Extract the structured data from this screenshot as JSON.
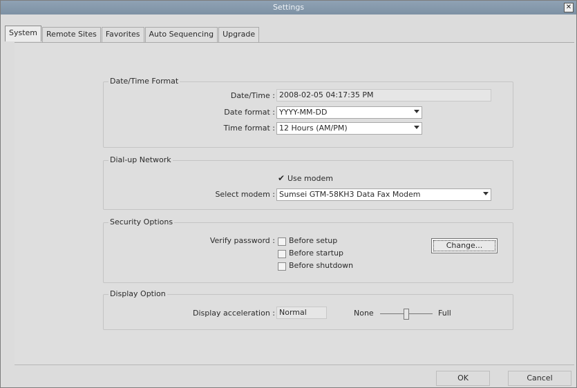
{
  "window": {
    "title": "Settings"
  },
  "tabs": [
    {
      "label": "System"
    },
    {
      "label": "Remote Sites"
    },
    {
      "label": "Favorites"
    },
    {
      "label": "Auto Sequencing"
    },
    {
      "label": "Upgrade"
    }
  ],
  "datetime": {
    "group_title": "Date/Time Format",
    "datetime_label": "Date/Time :",
    "datetime_value": "2008-02-05 04:17:35 PM",
    "date_format_label": "Date format :",
    "date_format_value": "YYYY-MM-DD",
    "time_format_label": "Time format :",
    "time_format_value": "12 Hours (AM/PM)"
  },
  "dialup": {
    "group_title": "Dial-up Network",
    "use_modem_label": "Use modem",
    "use_modem_checked": true,
    "select_modem_label": "Select modem :",
    "select_modem_value": "Sumsei GTM-58KH3 Data Fax Modem"
  },
  "security": {
    "group_title": "Security Options",
    "verify_label": "Verify password :",
    "before_setup": "Before setup",
    "before_startup": "Before startup",
    "before_shutdown": "Before shutdown",
    "change_button": "Change..."
  },
  "display": {
    "group_title": "Display Option",
    "accel_label": "Display acceleration :",
    "accel_value": "Normal",
    "none_label": "None",
    "full_label": "Full",
    "slider_level_fraction": 0.5
  },
  "footer": {
    "ok_button": "OK",
    "cancel_button": "Cancel"
  }
}
